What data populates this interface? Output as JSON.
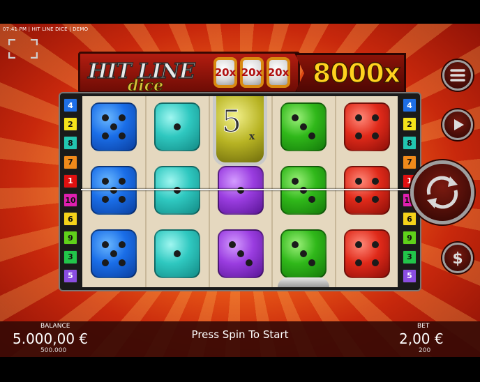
{
  "status_bar": "07:41 PM | HIT LINE DICE | DEMO",
  "logo": {
    "title": "HIT LINE",
    "subtitle": "dice",
    "multipliers": [
      "20x",
      "20x",
      "20x"
    ]
  },
  "max_win": "8000x",
  "multiplier_reel": {
    "value": "5",
    "suffix": "x"
  },
  "left_line_numbers": [
    "4",
    "2",
    "8",
    "7",
    "1",
    "10",
    "6",
    "9",
    "3",
    "5"
  ],
  "right_line_numbers": [
    "4",
    "2",
    "8",
    "7",
    "1",
    "10",
    "6",
    "9",
    "3",
    "5"
  ],
  "line_colors": {
    "1": "#e01010",
    "2": "#f5e31a",
    "3": "#22c64a",
    "4": "#1e6fe6",
    "5": "#8a4de0",
    "6": "#f5d31a",
    "7": "#f08a1a",
    "8": "#22c6b0",
    "9": "#5fd21a",
    "10": "#e01fb0"
  },
  "dice_grid": [
    [
      {
        "color": "blue",
        "value": 5
      },
      {
        "color": "teal",
        "value": 1
      },
      null,
      {
        "color": "green",
        "value": 3
      },
      {
        "color": "red",
        "value": 4
      }
    ],
    [
      {
        "color": "blue",
        "value": 5
      },
      {
        "color": "teal",
        "value": 1
      },
      {
        "color": "purple",
        "value": 1
      },
      {
        "color": "green",
        "value": 3
      },
      {
        "color": "red",
        "value": 4
      }
    ],
    [
      {
        "color": "blue",
        "value": 5
      },
      {
        "color": "teal",
        "value": 1
      },
      {
        "color": "purple",
        "value": 3
      },
      {
        "color": "green",
        "value": 3
      },
      {
        "color": "red",
        "value": 4
      }
    ]
  ],
  "icons": [
    "fullscreen-icon",
    "menu-icon",
    "play-icon",
    "spin-arrows-icon",
    "dollar-icon"
  ],
  "footer": {
    "balance_label": "BALANCE",
    "balance_value": "5.000,00 €",
    "balance_sub": "500.000",
    "message": "Press Spin To Start",
    "bet_label": "BET",
    "bet_value": "2,00 €",
    "bet_sub": "200"
  }
}
